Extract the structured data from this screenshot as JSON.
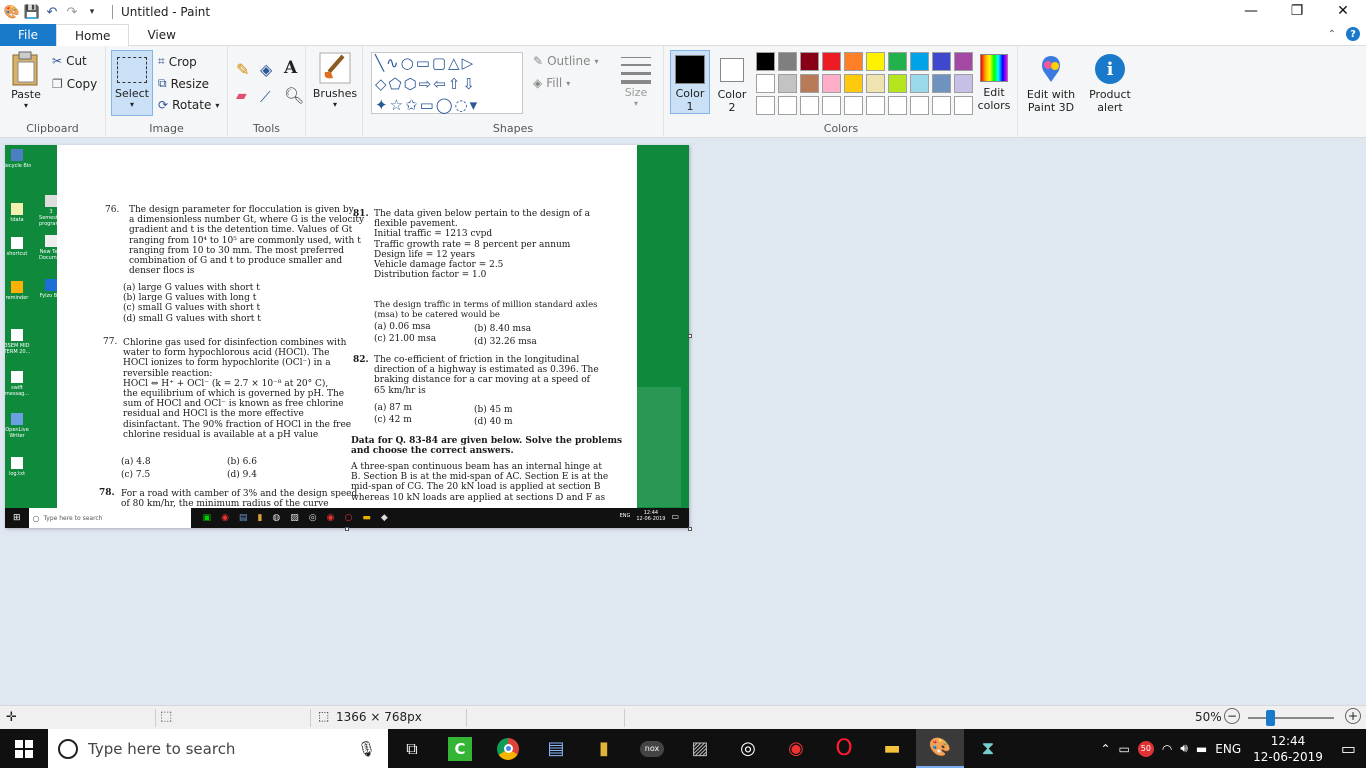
{
  "window": {
    "title": "Untitled - Paint",
    "min": "—",
    "max": "❐",
    "close": "✕"
  },
  "tabs": {
    "file": "File",
    "home": "Home",
    "view": "View"
  },
  "clipboard": {
    "paste": "Paste",
    "cut": "Cut",
    "copy": "Copy",
    "label": "Clipboard"
  },
  "image": {
    "select": "Select",
    "crop": "Crop",
    "resize": "Resize",
    "rotate": "Rotate",
    "label": "Image"
  },
  "tools": {
    "label": "Tools",
    "brushes": "Brushes"
  },
  "shapes": {
    "label": "Shapes",
    "outline": "Outline",
    "fill": "Fill",
    "size": "Size"
  },
  "colors": {
    "label": "Colors",
    "color1": "Color",
    "color1b": "1",
    "color2": "Color",
    "color2b": "2",
    "edit": "Edit",
    "editb": "colors",
    "paint3d": "Edit with",
    "paint3db": "Paint 3D",
    "alert": "Product",
    "alertb": "alert",
    "palette": [
      "#000000",
      "#7f7f7f",
      "#880015",
      "#ed1c24",
      "#ff7f27",
      "#fff200",
      "#22b14c",
      "#00a2e8",
      "#3f48cc",
      "#a349a4",
      "#ffffff",
      "#c3c3c3",
      "#b97a57",
      "#ffaec9",
      "#ffc90e",
      "#efe4b0",
      "#b5e61d",
      "#99d9ea",
      "#7092be",
      "#c8bfe7"
    ]
  },
  "status": {
    "dimensions": "1366 × 768px",
    "zoom": "50%"
  },
  "taskbar": {
    "search": "Type here to search",
    "lang": "ENG",
    "time": "12:44",
    "date": "12-06-2019",
    "badge": "50"
  },
  "mini": {
    "search": "Type here to search",
    "lang": "ENG",
    "time": "12:44",
    "date": "12-06-2019"
  },
  "desktop_icons": [
    "Recycle Bin",
    "tdata",
    "shortcut",
    "reminder",
    "3SEM MID TERM 20...",
    "swift messag...",
    "OpenLive Writer",
    "log.txt",
    "3 Semester program...",
    "New Text Document...",
    "Fylzo Bar"
  ],
  "doc": {
    "q76n": "76.",
    "q76": [
      "The design parameter for flocculation is given by",
      "a dimensionless number Gt, where G is the velocity",
      "gradient and t is the detention time. Values of Gt",
      "ranging from 10⁴ to 10⁵ are commonly used, with t",
      "ranging from 10 to 30 mm. The most preferred",
      "combination of G and t to produce smaller and",
      "denser flocs is"
    ],
    "q76opts": [
      "(a)  large G values with short t",
      "(b)  large G values with long t",
      "(c)  small G values with short t",
      "(d)  small G values with short t"
    ],
    "q77n": "77.",
    "q77": [
      "Chlorine gas used for disinfection combines with",
      "water to form hypochlorous acid (HOCl). The",
      "HOCl ionizes to form hypochlorite (OCl⁻) in a",
      "reversible reaction:",
      "HOCl ⇔ H⁺ + OCl⁻ (k = 2.7 × 10⁻⁸ at 20° C),",
      "the equilibrium of which is governed by pH. The",
      "sum of HOCl and OCl⁻ is known as free chlorine",
      "residual and HOCl is the more effective",
      "disinfactant. The 90% fraction of HOCl in the free",
      "chlorine residual is available at a pH value"
    ],
    "q77a": "(a)  4.8",
    "q77b": "(b)  6.6",
    "q77c": "(c)  7.5",
    "q77d": "(d)  9.4",
    "q78n": "78.",
    "q78": [
      "For a road with camber of 3% and the design speed",
      "of 80 km/hr, the minimum radius of the curve"
    ],
    "q81n": "81.",
    "q81": [
      "The data given below pertain to the design of a",
      "flexible pavement.",
      "Initial traffic = 1213 cvpd",
      "Traffic growth rate = 8 percent per annum",
      "Design life = 12 years",
      "Vehicle damage factor = 2.5",
      "Distribution factor = 1.0"
    ],
    "q81b": [
      "The design traffic in terms of million standard axles",
      "(msa) to be catered would be"
    ],
    "q81a": "(a)  0.06 msa",
    "q81bb": "(b)  8.40 msa",
    "q81c": "(c)  21.00 msa",
    "q81d": "(d)  32.26 msa",
    "q82n": "82.",
    "q82": [
      "The co-efficient of friction in the longitudinal",
      "direction of a highway is estimated as 0.396. The",
      "braking distance for a car moving at a speed of",
      "65 km/hr is"
    ],
    "q82a": "(a)  87 m",
    "q82b": "(b)  45 m",
    "q82c": "(c)  42 m",
    "q82d": "(d)  40 m",
    "datahead": [
      "Data for Q. 83-84 are given below. Solve the problems",
      "and choose the correct answers."
    ],
    "datatext": [
      "A three-span continuous beam has an internal hinge at",
      "B. Section B is at the mid-span of AC. Section E is at the",
      "mid-span of CG. The 20 kN load is applied at section B",
      "whereas 10 kN loads are applied at sections D and F as"
    ]
  }
}
